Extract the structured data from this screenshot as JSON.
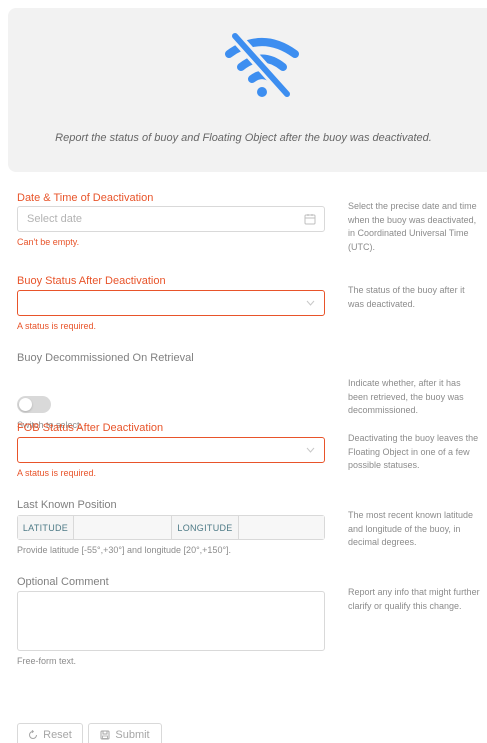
{
  "banner": {
    "icon": "wifi-off-icon",
    "icon_color": "#3d8ef0",
    "text": "Report the status of buoy and Floating Object after the buoy was deactivated."
  },
  "fields": {
    "deactivation_datetime": {
      "label": "Date & Time of Deactivation",
      "placeholder": "Select date",
      "error": "Can't be empty.",
      "description": "Select the precise date and time when the buoy was deactivated, in Coordinated Universal Time (UTC)."
    },
    "buoy_status": {
      "label": "Buoy Status After Deactivation",
      "value": "",
      "error": "A status is required.",
      "description": "The status of the buoy after it was deactivated."
    },
    "decommissioned": {
      "label": "Buoy Decommissioned On Retrieval",
      "help": "Switch to select.",
      "checked": false,
      "description": "Indicate whether, after it has been retrieved, the buoy was decommissioned."
    },
    "fob_status": {
      "label": "FOB Status After Deactivation",
      "value": "",
      "error": "A status is required.",
      "description": "Deactivating the buoy leaves the Floating Object in one of a few possible statuses."
    },
    "last_position": {
      "label": "Last Known Position",
      "latitude_addon": "LATITUDE",
      "longitude_addon": "LONGITUDE",
      "latitude_value": "",
      "longitude_value": "",
      "help": "Provide latitude [-55°,+30°] and longitude [20°,+150°].",
      "description": "The most recent known latitude and longitude of the buoy, in decimal degrees."
    },
    "comment": {
      "label": "Optional Comment",
      "value": "",
      "help": "Free-form text.",
      "description": "Report any info that might further clarify or qualify this change."
    }
  },
  "actions": {
    "reset_label": "Reset",
    "submit_label": "Submit"
  },
  "colors": {
    "error": "#e8542a",
    "accent": "#3d8ef0",
    "border": "#d9d9d9"
  }
}
